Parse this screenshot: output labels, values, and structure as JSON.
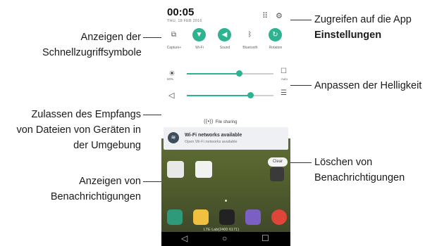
{
  "callouts": {
    "settings_line1": "Zugreifen auf die App",
    "settings_line2": "Einstellungen",
    "quick_line1": "Anzeigen der",
    "quick_line2": "Schnellzugriffsymbole",
    "brightness": "Anpassen der Helligkeit",
    "files_line1": "Zulassen des Empfangs",
    "files_line2": "von Dateien von Geräten in",
    "files_line3": "der Umgebung",
    "notif_line1": "Anzeigen von",
    "notif_line2": "Benachrichtigungen",
    "clear_line1": "Löschen von",
    "clear_line2": "Benachrichtigungen"
  },
  "phone": {
    "time": "00:05",
    "date": "THU, 18 FEB 2016",
    "header_icons": [
      "grid-icon",
      "gear-icon"
    ],
    "quick_tiles": [
      {
        "label": "Capture+",
        "icon": "capture-icon",
        "on": false
      },
      {
        "label": "Wi-Fi",
        "icon": "wifi-icon",
        "on": true
      },
      {
        "label": "Sound",
        "icon": "sound-icon",
        "on": true
      },
      {
        "label": "Bluetooth",
        "icon": "bluetooth-icon",
        "on": false
      },
      {
        "label": "Rotation",
        "icon": "rotation-icon",
        "on": true
      }
    ],
    "brightness": {
      "sub_label": "60%",
      "level_percent": 60,
      "auto_label": "Auto"
    },
    "volume": {
      "level_percent": 73
    },
    "file_sharing": "File sharing",
    "notification": {
      "title": "Wi-Fi networks available",
      "subtitle": "Open Wi-Fi networks available"
    },
    "clear_label": "Clear",
    "carrier": "LTE Lab(2400 6171)",
    "accent_color": "#2db38f"
  }
}
